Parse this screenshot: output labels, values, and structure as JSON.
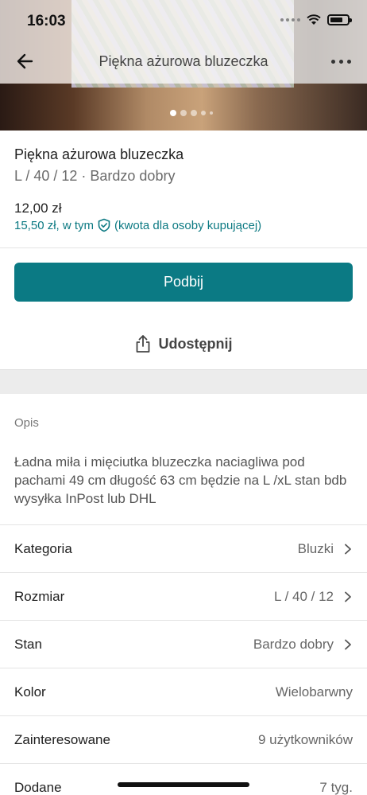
{
  "status": {
    "time": "16:03"
  },
  "nav": {
    "title": "Piękna ażurowa bluzeczka"
  },
  "item": {
    "title": "Piękna ażurowa bluzeczka",
    "subtitle": "L / 40 / 12 · Bardzo dobry",
    "price": "12,00 zł",
    "total_price": "15,50 zł, w tym",
    "buyer_protection": "(kwota dla osoby kupującej)"
  },
  "actions": {
    "bump_label": "Podbij",
    "share_label": "Udostępnij"
  },
  "description": {
    "label": "Opis",
    "text": "Ładna miła i mięciutka bluzeczka naciagliwa pod pachami 49 cm długość 63 cm będzie na L /xL stan bdb wysyłka InPost lub DHL"
  },
  "details": [
    {
      "label": "Kategoria",
      "value": "Bluzki",
      "chevron": true
    },
    {
      "label": "Rozmiar",
      "value": "L / 40 / 12",
      "chevron": true
    },
    {
      "label": "Stan",
      "value": "Bardzo dobry",
      "chevron": true
    },
    {
      "label": "Kolor",
      "value": "Wielobarwny",
      "chevron": false
    },
    {
      "label": "Zainteresowane",
      "value": "9 użytkowników",
      "chevron": false
    },
    {
      "label": "Dodane",
      "value": "7 tyg.",
      "chevron": false
    }
  ],
  "carousel": {
    "count": 5,
    "active_index": 0
  },
  "colors": {
    "accent": "#0b7a84",
    "link": "#0d7a83"
  }
}
